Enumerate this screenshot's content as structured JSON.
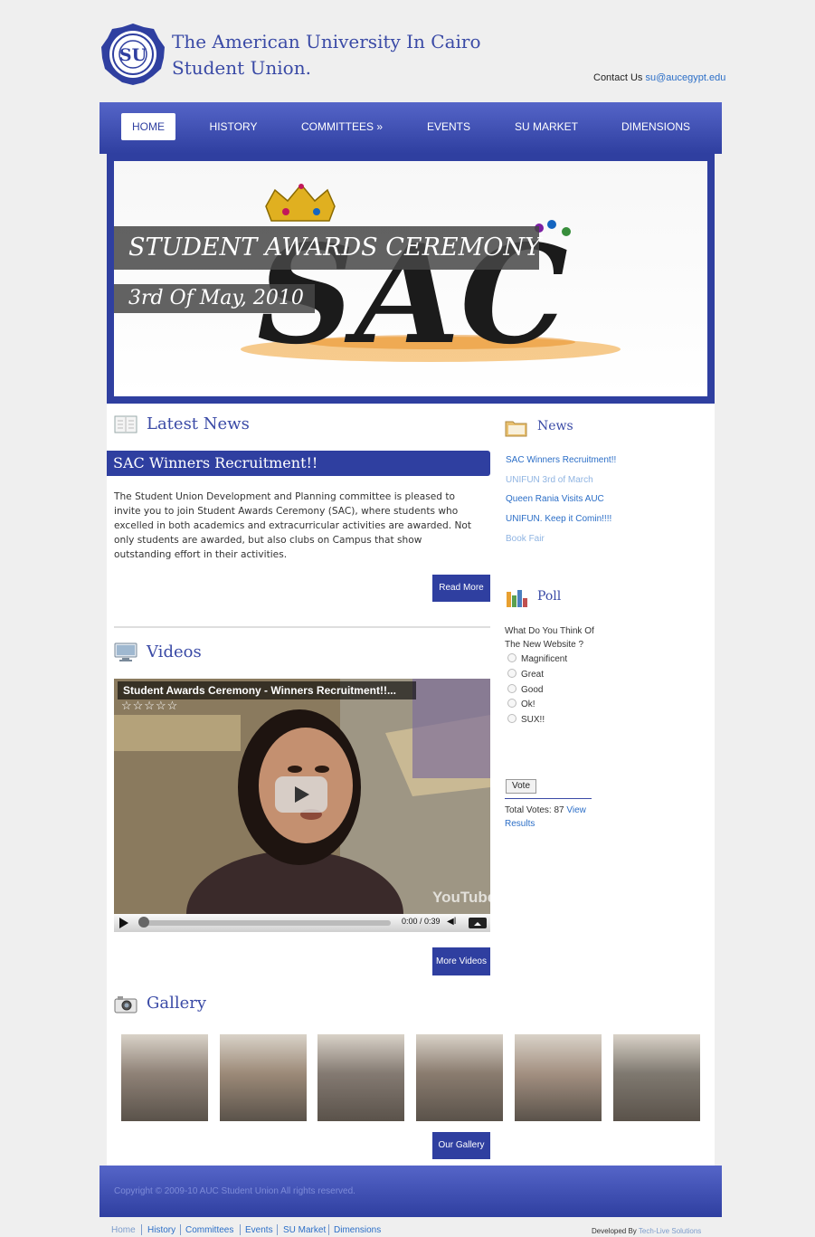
{
  "header": {
    "title_line1": "The American University In Cairo",
    "title_line2": "Student Union.",
    "logo_letters": "SU",
    "contact_label": "Contact Us",
    "contact_email": "su@aucegypt.edu"
  },
  "nav": {
    "items": [
      {
        "label": "HOME",
        "active": true
      },
      {
        "label": "HISTORY"
      },
      {
        "label": "COMMITTEES »"
      },
      {
        "label": "EVENTS"
      },
      {
        "label": "SU MARKET"
      },
      {
        "label": "DIMENSIONS"
      }
    ]
  },
  "banner": {
    "title": "STUDENT AWARDS CEREMONY",
    "date": "3rd Of May, 2010",
    "logo_text": "SAC"
  },
  "latest_news": {
    "heading": "Latest News",
    "article_title": "SAC Winners Recruitment!!",
    "article_body": "The Student Union Development and Planning committee is pleased to invite you to join Student Awards Ceremony (SAC), where students who excelled in both academics and extracurricular activities are awarded. Not only students are awarded, but also clubs on Campus that show outstanding effort in their activities.",
    "read_more": "Read More"
  },
  "videos": {
    "heading": "Videos",
    "video_title": "Student Awards Ceremony - Winners Recruitment!!...",
    "stars": "☆☆☆☆☆",
    "time": "0:00 / 0:39",
    "watermark": "YouTube",
    "more_videos": "More Videos"
  },
  "gallery": {
    "heading": "Gallery",
    "our_gallery": "Our Gallery",
    "thumb_colors": [
      "#8f8277",
      "#9c8a78",
      "#847a72",
      "#8a7c6f",
      "#a39081",
      "#7f7970"
    ]
  },
  "sidebar": {
    "news_heading": "News",
    "news_links": [
      "SAC Winners Recruitment!!",
      "UNIFUN 3rd of March",
      "Queen Rania Visits AUC",
      "UNIFUN. Keep it Comin!!!!",
      "Book Fair"
    ],
    "poll_heading": "Poll",
    "poll_question": "What Do You Think Of The New Website ?",
    "poll_options": [
      "Magnificent",
      "Great",
      "Good",
      "Ok!",
      "SUX!!"
    ],
    "vote_label": "Vote",
    "total_votes": "Total Votes: 87",
    "view_results": "View Results"
  },
  "footer": {
    "copyright": "Copyright © 2009-10 AUC Student Union All rights reserved.",
    "links": [
      "Home",
      "History",
      "Committees",
      "Events",
      "SU Market",
      "Dimensions"
    ],
    "developed_by": "Developed By",
    "developer": "Tech-Live Solutions"
  },
  "colors": {
    "brand_blue": "#2f3fa0",
    "link_blue": "#2b6ec7",
    "background": "#efefef"
  }
}
